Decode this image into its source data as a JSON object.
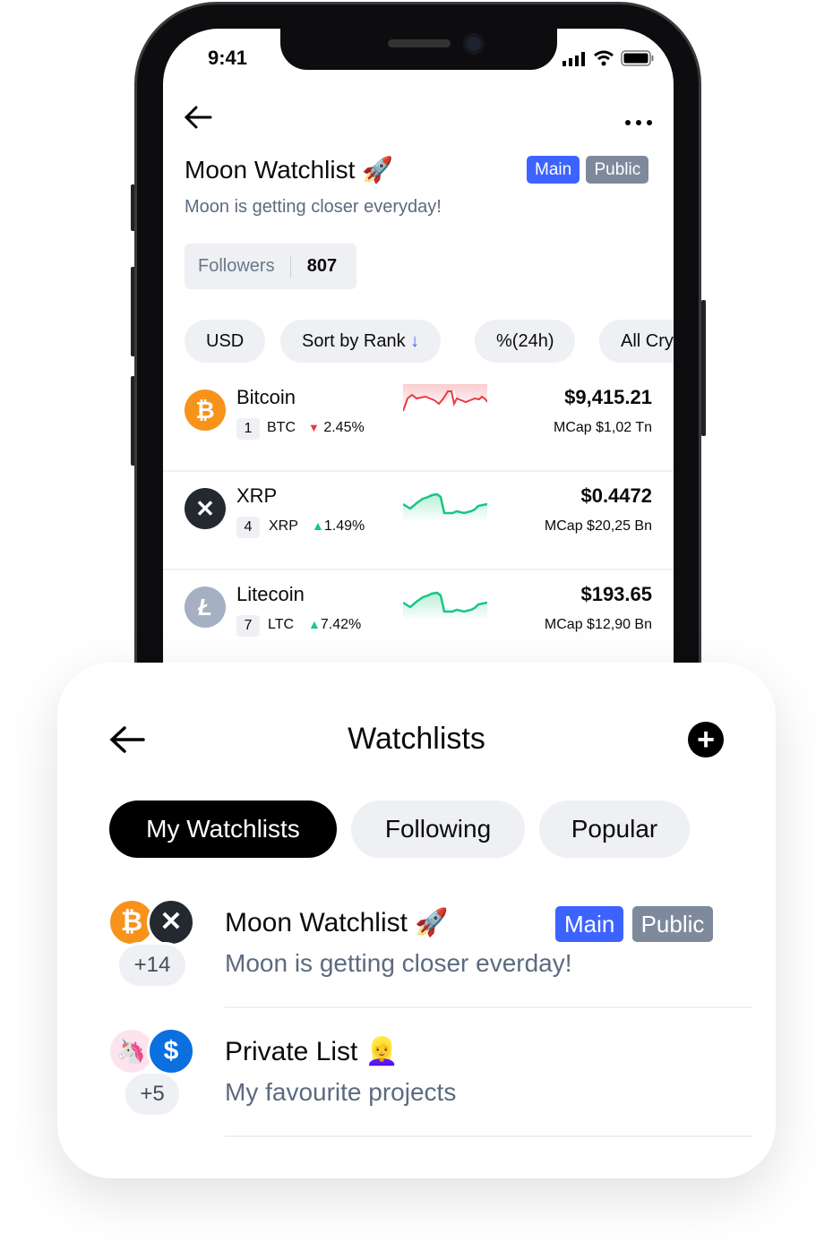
{
  "status_bar": {
    "time": "9:41"
  },
  "detail": {
    "title": "Moon Watchlist",
    "title_emoji": "🚀",
    "tags": [
      "Main",
      "Public"
    ],
    "description": "Moon is getting closer everyday!",
    "followers_label": "Followers",
    "followers_count": "807",
    "filters": [
      "USD",
      "Sort by Rank",
      "%(24h)",
      "All Cry"
    ],
    "sort_icon": "arrow-down-icon",
    "coins": [
      {
        "name": "Bitcoin",
        "rank": "1",
        "symbol": "BTC",
        "change": "2.45%",
        "direction": "down",
        "price": "$9,415.21",
        "mcap": "MCap $1,02 Tn",
        "color": "#f7931a"
      },
      {
        "name": "XRP",
        "rank": "4",
        "symbol": "XRP",
        "change": "1.49%",
        "direction": "up",
        "price": "$0.4472",
        "mcap": "MCap $20,25 Bn",
        "color": "#23292f"
      },
      {
        "name": "Litecoin",
        "rank": "7",
        "symbol": "LTC",
        "change": "7.42%",
        "direction": "up",
        "price": "$193.65",
        "mcap": "MCap $12,90 Bn",
        "color": "#a6b0c3"
      }
    ]
  },
  "colors": {
    "accent": "#3d63ff",
    "tag_gray": "#7e8a9c",
    "up": "#16c784",
    "down": "#ea3943"
  },
  "watchlists": {
    "title": "Watchlists",
    "tabs": [
      "My Watchlists",
      "Following",
      "Popular"
    ],
    "items": [
      {
        "title": "Moon Watchlist",
        "emoji": "🚀",
        "tags": [
          "Main",
          "Public"
        ],
        "description": "Moon is getting closer everday!",
        "more": "+14"
      },
      {
        "title": "Private List",
        "emoji": "👱‍♀️",
        "description": "My favourite projects",
        "more": "+5"
      }
    ]
  }
}
